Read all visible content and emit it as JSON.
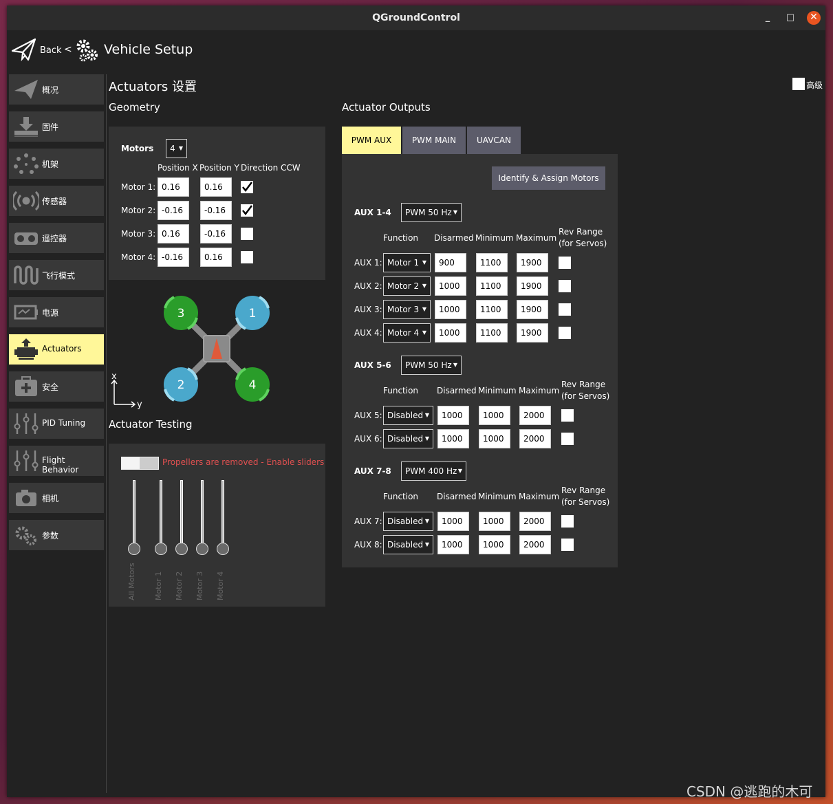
{
  "window": {
    "title": "QGroundControl",
    "minimize": "_",
    "maximize": "□",
    "close": "✕"
  },
  "toolbar": {
    "back_label": "Back",
    "separator": "<",
    "title": "Vehicle Setup"
  },
  "sidebar": {
    "items": [
      {
        "label": "概况",
        "icon": "paper-plane-icon"
      },
      {
        "label": "固件",
        "icon": "download-icon"
      },
      {
        "label": "机架",
        "icon": "airframe-icon"
      },
      {
        "label": "传感器",
        "icon": "radio-waves-icon"
      },
      {
        "label": "遥控器",
        "icon": "remote-control-icon"
      },
      {
        "label": "飞行模式",
        "icon": "wave-icon"
      },
      {
        "label": "电源",
        "icon": "battery-icon"
      },
      {
        "label": "Actuators",
        "icon": "actuator-icon"
      },
      {
        "label": "安全",
        "icon": "first-aid-icon"
      },
      {
        "label": "PID Tuning",
        "icon": "sliders-icon"
      },
      {
        "label": "Flight Behavior",
        "icon": "sliders-icon"
      },
      {
        "label": "相机",
        "icon": "camera-icon"
      },
      {
        "label": "参数",
        "icon": "gears-icon"
      }
    ],
    "active_index": 7
  },
  "page": {
    "title": "Actuators 设置",
    "advanced_label": "高级",
    "advanced_checked": false
  },
  "geometry": {
    "section_title": "Geometry",
    "motors_label": "Motors",
    "motors_count": "4",
    "col_headers": [
      "Position X",
      "Position Y",
      "Direction CCW"
    ],
    "rows": [
      {
        "label": "Motor 1:",
        "x": "0.16",
        "y": "0.16",
        "ccw": true
      },
      {
        "label": "Motor 2:",
        "x": "-0.16",
        "y": "-0.16",
        "ccw": true
      },
      {
        "label": "Motor 3:",
        "x": "0.16",
        "y": "-0.16",
        "ccw": false
      },
      {
        "label": "Motor 4:",
        "x": "-0.16",
        "y": "0.16",
        "ccw": false
      }
    ],
    "diagram": {
      "motor_labels": [
        "3",
        "1",
        "2",
        "4"
      ],
      "axis_x": "x",
      "axis_y": "y"
    }
  },
  "testing": {
    "section_title": "Actuator Testing",
    "warning": "Propellers are removed - Enable sliders",
    "sliders": [
      "All Motors",
      "Motor 1",
      "Motor 2",
      "Motor 3",
      "Motor 4"
    ]
  },
  "outputs": {
    "section_title": "Actuator Outputs",
    "tabs": [
      "PWM AUX",
      "PWM MAIN",
      "UAVCAN"
    ],
    "active_tab": 0,
    "identify_button": "Identify & Assign Motors",
    "col_headers": [
      "Function",
      "Disarmed",
      "Minimum",
      "Maximum",
      "Rev Range",
      "(for Servos)"
    ],
    "groups": [
      {
        "name": "AUX 1-4",
        "rate": "PWM 50 Hz",
        "rows": [
          {
            "label": "AUX 1:",
            "function": "Motor 1",
            "disarmed": "900",
            "min": "1100",
            "max": "1900"
          },
          {
            "label": "AUX 2:",
            "function": "Motor 2",
            "disarmed": "1000",
            "min": "1100",
            "max": "1900"
          },
          {
            "label": "AUX 3:",
            "function": "Motor 3",
            "disarmed": "1000",
            "min": "1100",
            "max": "1900"
          },
          {
            "label": "AUX 4:",
            "function": "Motor 4",
            "disarmed": "1000",
            "min": "1100",
            "max": "1900"
          }
        ]
      },
      {
        "name": "AUX 5-6",
        "rate": "PWM 50 Hz",
        "rows": [
          {
            "label": "AUX 5:",
            "function": "Disabled",
            "disarmed": "1000",
            "min": "1000",
            "max": "2000"
          },
          {
            "label": "AUX 6:",
            "function": "Disabled",
            "disarmed": "1000",
            "min": "1000",
            "max": "2000"
          }
        ]
      },
      {
        "name": "AUX 7-8",
        "rate": "PWM 400 Hz",
        "rows": [
          {
            "label": "AUX 7:",
            "function": "Disabled",
            "disarmed": "1000",
            "min": "1000",
            "max": "2000"
          },
          {
            "label": "AUX 8:",
            "function": "Disabled",
            "disarmed": "1000",
            "min": "1000",
            "max": "2000"
          }
        ]
      }
    ]
  },
  "watermark": "CSDN @逃跑的木可",
  "colors": {
    "active_item": "#fff799",
    "accent_red": "#e05050",
    "motor_green": "#2a9d2a",
    "motor_blue": "#4aa8cc"
  }
}
